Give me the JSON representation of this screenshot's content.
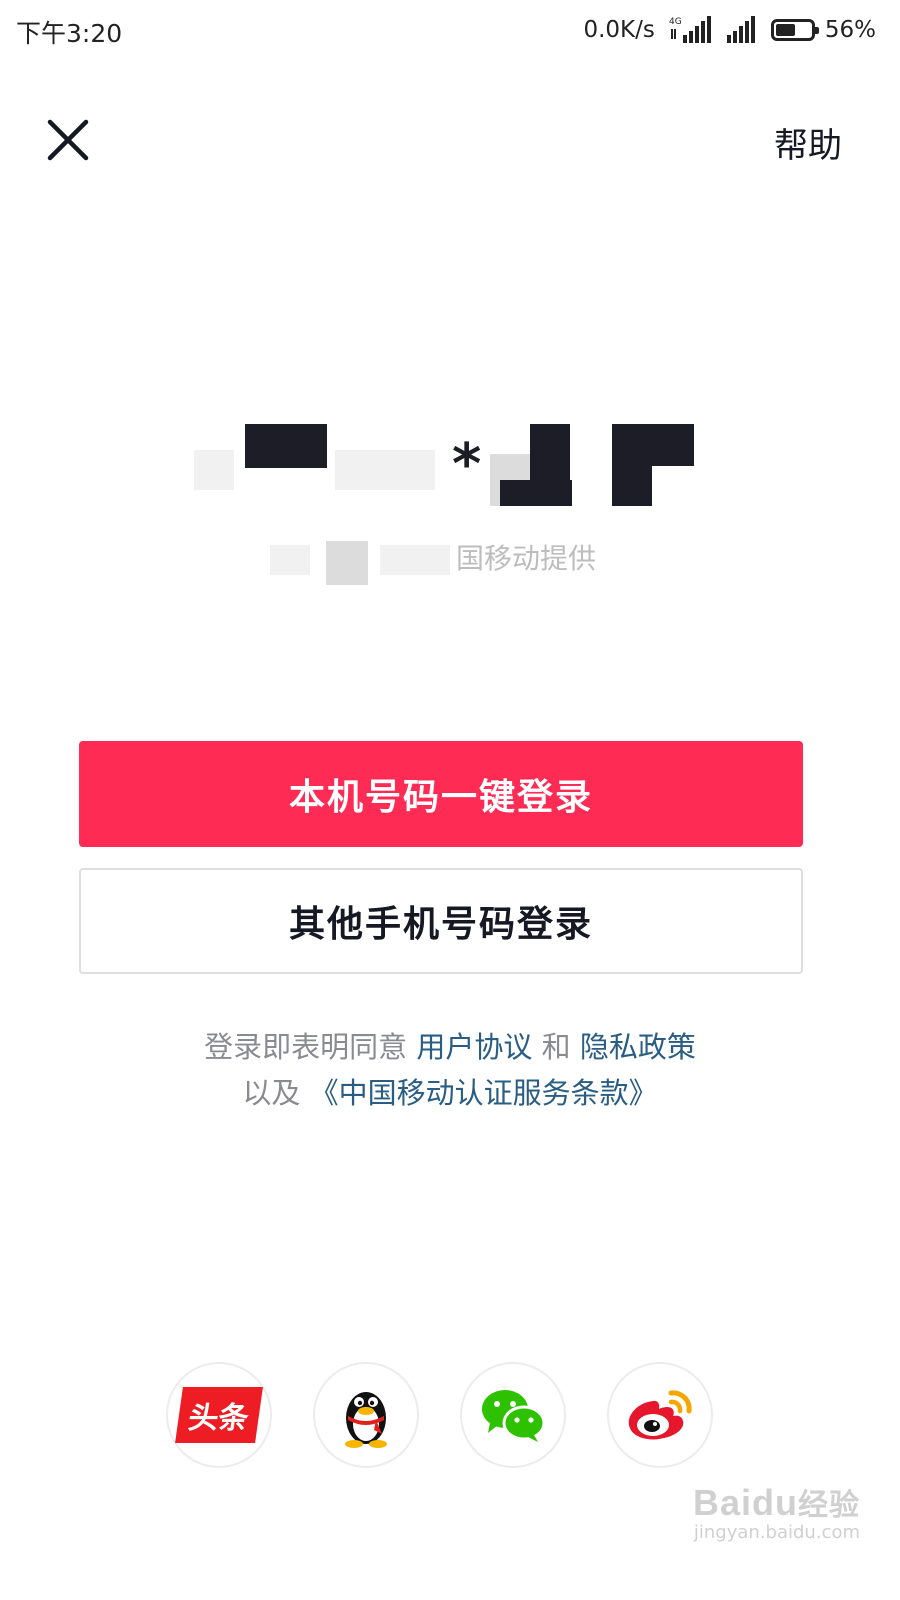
{
  "status_bar": {
    "time": "下午3:20",
    "net_speed": "0.0K/s",
    "network_type": "4G",
    "battery_percent": "56%",
    "battery_level": 0.56
  },
  "nav": {
    "close_icon": "close-icon",
    "help_label": "帮助"
  },
  "phone_area": {
    "masked_char": "*",
    "carrier_text": "国移动提供"
  },
  "buttons": {
    "one_click_login": "本机号码一键登录",
    "other_phone_login": "其他手机号码登录"
  },
  "agreement": {
    "prefix": "登录即表明同意",
    "user_agreement": "用户协议",
    "and": "和",
    "privacy_policy": "隐私政策",
    "also": "以及",
    "carrier_terms": "《中国移动认证服务条款》"
  },
  "social_login": [
    {
      "icon": "toutiao-icon",
      "label": "头条"
    },
    {
      "icon": "qq-penguin-icon"
    },
    {
      "icon": "wechat-icon"
    },
    {
      "icon": "weibo-icon"
    }
  ],
  "watermark": {
    "brand": "Baidu",
    "brand_cn": "经验",
    "url": "jingyan.baidu.com"
  },
  "colors": {
    "primary": "#fe2c55",
    "link": "#2a5d84",
    "muted_text": "#8a8b91"
  }
}
